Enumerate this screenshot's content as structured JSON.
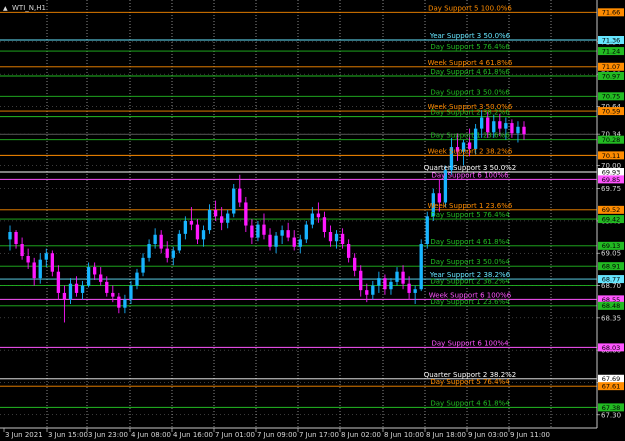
{
  "window": {
    "symbol_title": "WTI_N,H1",
    "arrow_glyph": "▲"
  },
  "colors": {
    "background": "#000000",
    "grid": "#c8c8c8",
    "bull": "#18b4ff",
    "bear": "#ff18ff",
    "axis_text": "#d8d8d8"
  },
  "axis": {
    "price_min": 67.2,
    "price_max": 71.75,
    "price_labels": [
      "71.34",
      "70.99",
      "70.64",
      "70.34",
      "70.00",
      "69.75",
      "69.40",
      "69.05",
      "68.70",
      "68.35",
      "68.00",
      "67.65",
      "67.30"
    ],
    "time_labels": [
      "3 Jun 2021",
      "3 Jun 15:00",
      "3 Jun 23:00",
      "4 Jun 08:00",
      "4 Jun 16:00",
      "7 Jun 01:00",
      "7 Jun 09:00",
      "7 Jun 17:00",
      "8 Jun 02:00",
      "8 Jun 10:00",
      "8 Jun 18:00",
      "9 Jun 03:00",
      "9 Jun 11:00"
    ]
  },
  "levels": [
    {
      "text": "Day Support 5 100.0%6",
      "price": 71.66,
      "tag": "71.66",
      "color": "#ff8c00",
      "tag_color": "#ff8c00",
      "y_text_offset": 0
    },
    {
      "text": "Year Support 3 50.0%6",
      "price": 71.36,
      "tag": "71.36",
      "color": "#66e6ff",
      "tag_color": "#66e6ff",
      "y_text_offset": 0
    },
    {
      "text": "Day Support 5 76.4%6",
      "price": 71.24,
      "tag": "71.24",
      "color": "#22bb22",
      "tag_color": "#22bb22",
      "y_text_offset": 0
    },
    {
      "text": "Week Support 4 61.8%6",
      "price": 71.07,
      "tag": "71.07",
      "color": "#ff8c00",
      "tag_color": "#ff8c00",
      "y_text_offset": 0
    },
    {
      "text": "Day Support 4 61.8%6",
      "price": 70.97,
      "tag": "70.97",
      "color": "#22bb22",
      "tag_color": "#22bb22",
      "y_text_offset": 0
    },
    {
      "text": "Day Support 3 50.0%6",
      "price": 70.75,
      "tag": "70.75",
      "color": "#22bb22",
      "tag_color": "#22bb22",
      "y_text_offset": 0
    },
    {
      "text": "Week Support 3 50.0%6",
      "price": 70.59,
      "tag": "70.59",
      "color": "#ff8c00",
      "tag_color": "#ff8c00",
      "y_text_offset": 0
    },
    {
      "text": "Day Support 2 38.2%6",
      "price": 70.53,
      "tag": "",
      "color": "#22bb22",
      "tag_color": "#22bb22",
      "y_text_offset": 0
    },
    {
      "text": "Day Support 1 23.6%6",
      "price": 70.28,
      "tag": "70.28",
      "color": "#22bb22",
      "tag_color": "#22bb22",
      "y_text_offset": 0
    },
    {
      "text": "Week Support 2 38.2%6",
      "price": 70.11,
      "tag": "70.11",
      "color": "#ff8c00",
      "tag_color": "#ff8c00",
      "y_text_offset": 0
    },
    {
      "text": "Quarter Support 3 50.0%2",
      "price": 69.93,
      "tag": "69.93",
      "color": "#ffffff",
      "tag_color": "#ffffff",
      "y_text_offset": 0
    },
    {
      "text": "Day Support 6 100%6",
      "price": 69.85,
      "tag": "69.85",
      "color": "#ff55ff",
      "tag_color": "#ff55ff",
      "y_text_offset": 0
    },
    {
      "text": "Week Support 1 23.6%6",
      "price": 69.52,
      "tag": "69.52",
      "color": "#ff8c00",
      "tag_color": "#ff8c00",
      "y_text_offset": 0
    },
    {
      "text": "Day Support 5 76.4%4",
      "price": 69.42,
      "tag": "69.42",
      "color": "#22bb22",
      "tag_color": "#22bb22",
      "y_text_offset": 0
    },
    {
      "text": "Day Support 4 61.8%4",
      "price": 69.13,
      "tag": "69.13",
      "color": "#22bb22",
      "tag_color": "#22bb22",
      "y_text_offset": 0
    },
    {
      "text": "Day Support 3 50.0%4",
      "price": 68.91,
      "tag": "68.91",
      "color": "#22bb22",
      "tag_color": "#22bb22",
      "y_text_offset": 0
    },
    {
      "text": "Year Support 2 38.2%6",
      "price": 68.77,
      "tag": "68.77",
      "color": "#66e6ff",
      "tag_color": "#66e6ff",
      "y_text_offset": 0
    },
    {
      "text": "Day Support 2 38.2%4",
      "price": 68.7,
      "tag": "",
      "color": "#22bb22",
      "tag_color": "#22bb22",
      "y_text_offset": 0
    },
    {
      "text": "Week Support 6 100%6",
      "price": 68.55,
      "tag": "68.55",
      "color": "#ff55ff",
      "tag_color": "#ff55ff",
      "y_text_offset": 0
    },
    {
      "text": "Day Support 1 23.6%4",
      "price": 68.48,
      "tag": "68.48",
      "color": "#22bb22",
      "tag_color": "#22bb22",
      "y_text_offset": 0
    },
    {
      "text": "Day Support 6 100%4",
      "price": 68.03,
      "tag": "68.03",
      "color": "#ff55ff",
      "tag_color": "#ff55ff",
      "y_text_offset": 0
    },
    {
      "text": "Quarter Support 2 38.2%2",
      "price": 67.69,
      "tag": "67.69",
      "color": "#ffffff",
      "tag_color": "#ffffff",
      "y_text_offset": 0
    },
    {
      "text": "Day Support 5 76.4%4",
      "price": 67.61,
      "tag": "67.61",
      "color": "#ff8c00",
      "tag_color": "#ff8c00",
      "y_text_offset": 0
    },
    {
      "text": "Day Support 4 61.8%4",
      "price": 67.38,
      "tag": "67.38",
      "color": "#22bb22",
      "tag_color": "#22bb22",
      "y_text_offset": 0
    }
  ],
  "candles": [
    [
      69.2,
      69.35,
      69.08,
      69.28
    ],
    [
      69.28,
      69.3,
      69.1,
      69.15
    ],
    [
      69.15,
      69.22,
      68.98,
      69.02
    ],
    [
      69.02,
      69.1,
      68.88,
      68.95
    ],
    [
      68.95,
      69.0,
      68.7,
      68.78
    ],
    [
      68.78,
      69.05,
      68.72,
      68.98
    ],
    [
      68.98,
      69.1,
      68.9,
      69.05
    ],
    [
      69.05,
      69.08,
      68.8,
      68.85
    ],
    [
      68.85,
      68.92,
      68.55,
      68.62
    ],
    [
      68.62,
      68.7,
      68.3,
      68.55
    ],
    [
      68.55,
      68.78,
      68.5,
      68.72
    ],
    [
      68.72,
      68.8,
      68.58,
      68.62
    ],
    [
      68.62,
      68.75,
      68.55,
      68.7
    ],
    [
      68.7,
      68.95,
      68.68,
      68.9
    ],
    [
      68.9,
      68.95,
      68.76,
      68.82
    ],
    [
      68.82,
      68.9,
      68.7,
      68.74
    ],
    [
      68.74,
      68.8,
      68.58,
      68.62
    ],
    [
      68.62,
      68.7,
      68.52,
      68.58
    ],
    [
      68.58,
      68.62,
      68.4,
      68.46
    ],
    [
      68.46,
      68.6,
      68.4,
      68.55
    ],
    [
      68.55,
      68.75,
      68.5,
      68.7
    ],
    [
      68.7,
      68.88,
      68.66,
      68.84
    ],
    [
      68.84,
      69.05,
      68.8,
      69.0
    ],
    [
      69.0,
      69.2,
      68.96,
      69.15
    ],
    [
      69.15,
      69.32,
      69.1,
      69.25
    ],
    [
      69.25,
      69.3,
      69.05,
      69.1
    ],
    [
      69.1,
      69.18,
      68.95,
      69.0
    ],
    [
      69.0,
      69.12,
      68.92,
      69.08
    ],
    [
      69.08,
      69.3,
      69.05,
      69.26
    ],
    [
      69.26,
      69.45,
      69.2,
      69.4
    ],
    [
      69.4,
      69.55,
      69.3,
      69.36
    ],
    [
      69.36,
      69.42,
      69.15,
      69.2
    ],
    [
      69.2,
      69.35,
      69.12,
      69.3
    ],
    [
      69.3,
      69.58,
      69.26,
      69.52
    ],
    [
      69.52,
      69.62,
      69.4,
      69.45
    ],
    [
      69.45,
      69.55,
      69.3,
      69.38
    ],
    [
      69.38,
      69.52,
      69.32,
      69.48
    ],
    [
      69.48,
      69.8,
      69.44,
      69.75
    ],
    [
      69.75,
      69.9,
      69.55,
      69.6
    ],
    [
      69.6,
      69.66,
      69.28,
      69.35
    ],
    [
      69.35,
      69.42,
      69.15,
      69.22
    ],
    [
      69.22,
      69.4,
      69.18,
      69.36
    ],
    [
      69.36,
      69.48,
      69.2,
      69.25
    ],
    [
      69.25,
      69.32,
      69.08,
      69.12
    ],
    [
      69.12,
      69.28,
      69.05,
      69.24
    ],
    [
      69.24,
      69.35,
      69.15,
      69.3
    ],
    [
      69.3,
      69.38,
      69.18,
      69.22
    ],
    [
      69.22,
      69.3,
      69.08,
      69.12
    ],
    [
      69.12,
      69.25,
      69.05,
      69.2
    ],
    [
      69.2,
      69.4,
      69.16,
      69.36
    ],
    [
      69.36,
      69.55,
      69.32,
      69.48
    ],
    [
      69.48,
      69.6,
      69.38,
      69.44
    ],
    [
      69.44,
      69.5,
      69.22,
      69.28
    ],
    [
      69.28,
      69.35,
      69.12,
      69.18
    ],
    [
      69.18,
      69.3,
      69.1,
      69.26
    ],
    [
      69.26,
      69.32,
      69.1,
      69.15
    ],
    [
      69.15,
      69.2,
      68.95,
      69.0
    ],
    [
      69.0,
      69.05,
      68.8,
      68.86
    ],
    [
      68.86,
      68.92,
      68.58,
      68.65
    ],
    [
      68.65,
      68.72,
      68.52,
      68.6
    ],
    [
      68.6,
      68.75,
      68.55,
      68.7
    ],
    [
      68.7,
      68.85,
      68.62,
      68.78
    ],
    [
      68.78,
      68.82,
      68.6,
      68.66
    ],
    [
      68.66,
      68.78,
      68.6,
      68.74
    ],
    [
      68.74,
      68.9,
      68.7,
      68.85
    ],
    [
      68.85,
      68.92,
      68.66,
      68.72
    ],
    [
      68.72,
      68.8,
      68.55,
      68.62
    ],
    [
      68.62,
      68.7,
      68.5,
      68.66
    ],
    [
      68.66,
      69.2,
      68.64,
      69.15
    ],
    [
      69.15,
      69.5,
      69.1,
      69.45
    ],
    [
      69.45,
      69.75,
      69.4,
      69.7
    ],
    [
      69.7,
      69.85,
      69.5,
      69.6
    ],
    [
      69.6,
      70.0,
      69.55,
      69.95
    ],
    [
      69.95,
      70.3,
      69.9,
      70.2
    ],
    [
      70.2,
      70.35,
      70.05,
      70.15
    ],
    [
      70.15,
      70.28,
      70.0,
      70.25
    ],
    [
      70.25,
      70.4,
      70.1,
      70.18
    ],
    [
      70.18,
      70.45,
      70.12,
      70.4
    ],
    [
      70.4,
      70.6,
      70.3,
      70.52
    ],
    [
      70.52,
      70.58,
      70.3,
      70.36
    ],
    [
      70.36,
      70.55,
      70.3,
      70.48
    ],
    [
      70.48,
      70.56,
      70.32,
      70.4
    ],
    [
      70.4,
      70.52,
      70.28,
      70.46
    ],
    [
      70.46,
      70.5,
      70.3,
      70.35
    ],
    [
      70.35,
      70.48,
      70.25,
      70.42
    ],
    [
      70.42,
      70.48,
      70.28,
      70.34
    ]
  ],
  "candle_x_start": 10,
  "candle_x_end": 524
}
